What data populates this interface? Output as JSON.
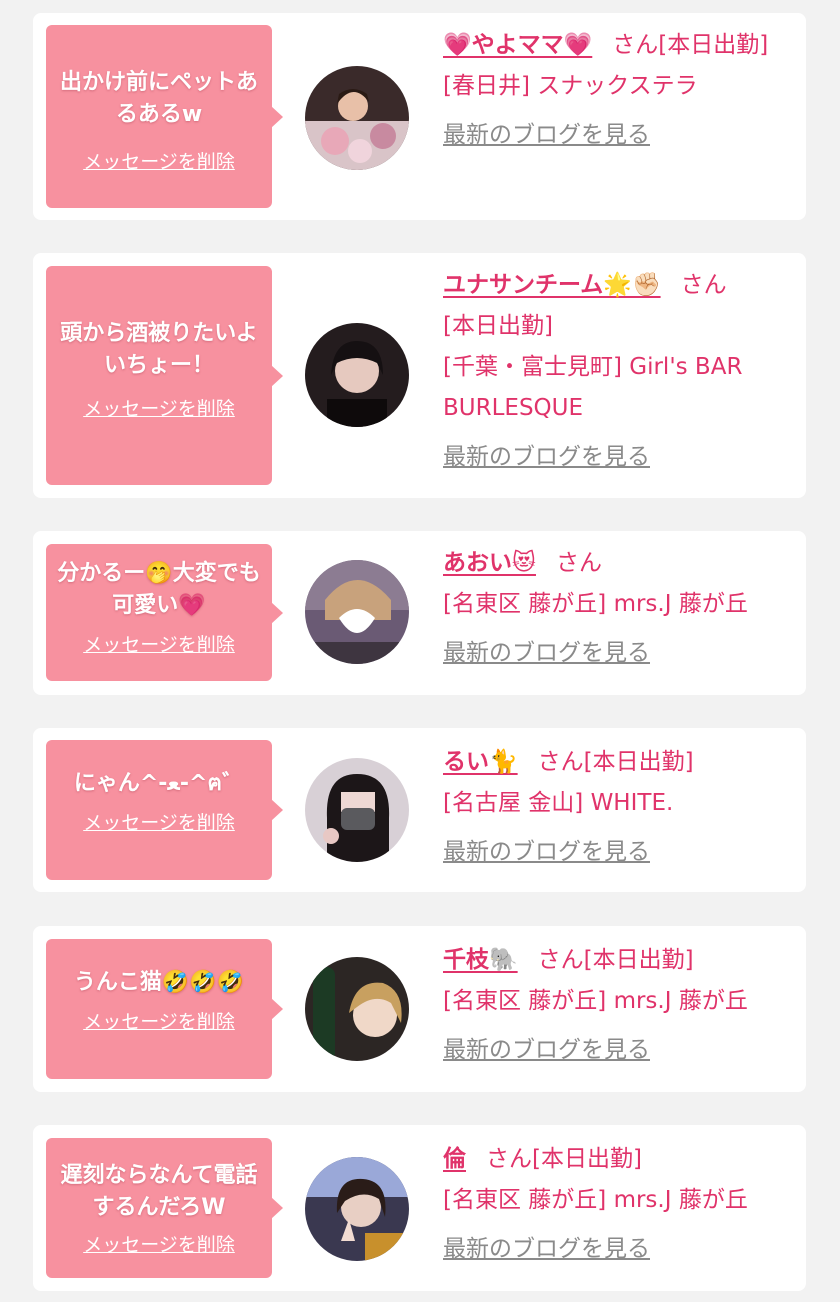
{
  "delete_label": "メッセージを削除",
  "blog_label": "最新のブログを見る",
  "san": "さん",
  "colors": {
    "bubble": "#f7919f",
    "accent": "#e0336a",
    "muted": "#8a8a8a",
    "background": "#f2f2f2"
  },
  "cards": [
    {
      "message": "出かけ前にペットあるあるw",
      "name": "💗やよママ💗",
      "status": "[本日出勤]",
      "location": "[春日井] スナックステラ"
    },
    {
      "message": "頭から酒被りたいよいちょー！",
      "name": "ユナサンチーム🌟✊🏻",
      "status": "[本日出勤]",
      "location": "[千葉・富士見町] Girl's BAR BURLESQUE"
    },
    {
      "message": "分かるー🤭大変でも可愛い💗",
      "name": "あおい😻",
      "status": "",
      "location": "[名東区 藤が丘] mrs.J 藤が丘"
    },
    {
      "message": "にゃん^-ﻌ-^ฅ゛",
      "name": "るい🐈",
      "status": "[本日出勤]",
      "location": "[名古屋 金山] WHITE."
    },
    {
      "message": "うんこ猫🤣🤣🤣",
      "name": "千枝🐘",
      "status": "[本日出勤]",
      "location": "[名東区 藤が丘] mrs.J 藤が丘"
    },
    {
      "message": "遅刻ならなんて電話するんだろW",
      "name": "倫",
      "status": "[本日出勤]",
      "location": "[名東区 藤が丘] mrs.J 藤が丘"
    }
  ]
}
